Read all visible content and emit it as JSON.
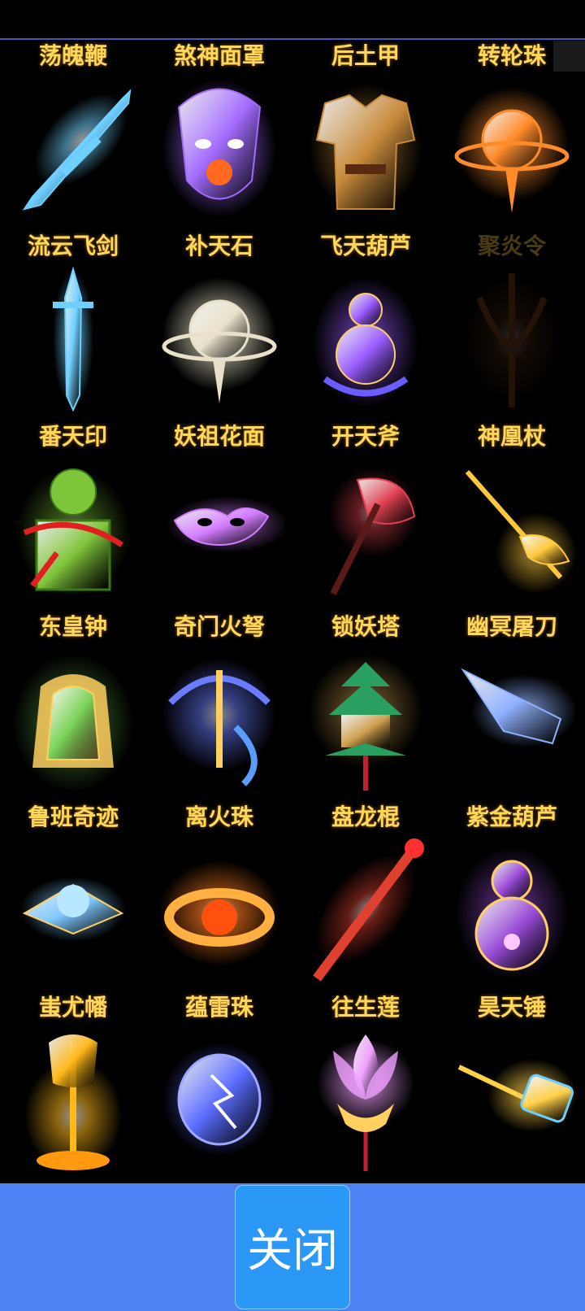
{
  "items": [
    {
      "label": "荡魄鞭",
      "icon": "whip-icon",
      "color": "#6fd0ff",
      "shape": "blade",
      "dim": false
    },
    {
      "label": "煞神面罩",
      "icon": "demon-mask-icon",
      "color": "#a36bff",
      "shape": "mask",
      "dim": false
    },
    {
      "label": "后土甲",
      "icon": "armor-icon",
      "color": "#c88a3a",
      "shape": "armor",
      "dim": false
    },
    {
      "label": "转轮珠",
      "icon": "wheel-orb-icon",
      "color": "#ff8a2a",
      "shape": "orb",
      "dim": false
    },
    {
      "label": "流云飞剑",
      "icon": "flying-sword-icon",
      "color": "#6fd0ff",
      "shape": "sword",
      "dim": false
    },
    {
      "label": "补天石",
      "icon": "sky-stone-icon",
      "color": "#e8e0c8",
      "shape": "orb",
      "dim": false
    },
    {
      "label": "飞天葫芦",
      "icon": "gourd-icon",
      "color": "#9a5cff",
      "shape": "gourd",
      "dim": false
    },
    {
      "label": "聚炎令",
      "icon": "flame-token-icon",
      "color": "#8a4a20",
      "shape": "trident",
      "dim": true
    },
    {
      "label": "番天印",
      "icon": "jade-seal-icon",
      "color": "#7fc53a",
      "shape": "seal",
      "dim": false
    },
    {
      "label": "妖祖花面",
      "icon": "flower-mask-icon",
      "color": "#d27bff",
      "shape": "smallmask",
      "dim": false
    },
    {
      "label": "开天斧",
      "icon": "axe-icon",
      "color": "#e04050",
      "shape": "axe",
      "dim": false
    },
    {
      "label": "神凰杖",
      "icon": "phoenix-staff-icon",
      "color": "#ffc83a",
      "shape": "staff",
      "dim": false
    },
    {
      "label": "东皇钟",
      "icon": "bell-icon",
      "color": "#7ad35a",
      "shape": "bell",
      "dim": false
    },
    {
      "label": "奇门火弩",
      "icon": "crossbow-icon",
      "color": "#6a7bff",
      "shape": "crossbow",
      "dim": false
    },
    {
      "label": "锁妖塔",
      "icon": "pagoda-icon",
      "color": "#d0a050",
      "shape": "pagoda",
      "dim": false
    },
    {
      "label": "幽冥屠刀",
      "icon": "blade-icon",
      "color": "#8fb0ff",
      "shape": "cleaver",
      "dim": false
    },
    {
      "label": "鲁班奇迹",
      "icon": "gadget-icon",
      "color": "#7fc8ff",
      "shape": "gadget",
      "dim": false
    },
    {
      "label": "离火珠",
      "icon": "fire-orb-icon",
      "color": "#ff7a20",
      "shape": "firering",
      "dim": false
    },
    {
      "label": "盘龙棍",
      "icon": "dragon-staff-icon",
      "color": "#e04030",
      "shape": "rod",
      "dim": false
    },
    {
      "label": "紫金葫芦",
      "icon": "purple-gourd-icon",
      "color": "#9a4cd8",
      "shape": "gourd2",
      "dim": false
    },
    {
      "label": "蚩尤幡",
      "icon": "banner-icon",
      "color": "#ffb81a",
      "shape": "banner",
      "dim": false
    },
    {
      "label": "蕴雷珠",
      "icon": "thunder-orb-icon",
      "color": "#5a6cff",
      "shape": "thunder",
      "dim": false
    },
    {
      "label": "往生莲",
      "icon": "lotus-icon",
      "color": "#f0a0ff",
      "shape": "lotus",
      "dim": false
    },
    {
      "label": "昊天锤",
      "icon": "hammer-icon",
      "color": "#ffd04a",
      "shape": "hammer",
      "dim": false
    }
  ],
  "close_button": {
    "label": "关闭"
  },
  "colors": {
    "background": "#000000",
    "label": "#ffd75a",
    "footer": "#4b83f5",
    "button": "#2b97f6"
  }
}
